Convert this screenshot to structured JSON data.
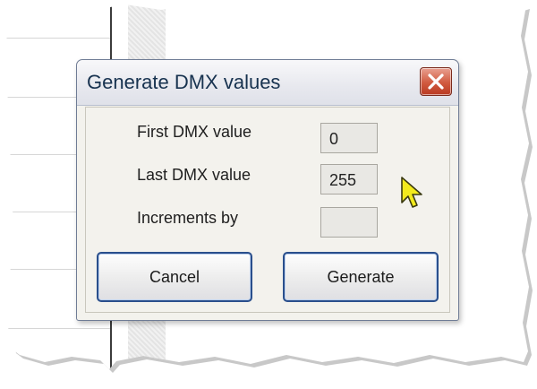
{
  "dialog": {
    "title": "Generate DMX values",
    "fields": [
      {
        "label": "First DMX value",
        "value": "0"
      },
      {
        "label": "Last DMX value",
        "value": "255"
      },
      {
        "label": "Increments by",
        "value": ""
      }
    ],
    "buttons": {
      "cancel": "Cancel",
      "generate": "Generate"
    }
  },
  "icons": {
    "close": "close-icon",
    "cursor": "mouse-pointer-icon"
  },
  "colors": {
    "close_button": "#d15a3f",
    "title_text": "#17324f",
    "button_border": "#2a4f8c",
    "cursor_fill": "#f2ea1c"
  }
}
